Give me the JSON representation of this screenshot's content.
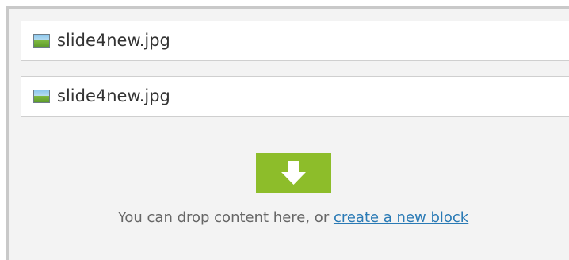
{
  "items": [
    {
      "filename": "slide4new.jpg",
      "icon": "image-file-icon"
    },
    {
      "filename": "slide4new.jpg",
      "icon": "image-file-icon"
    }
  ],
  "drop_zone": {
    "icon": "down-arrow-icon",
    "message": "You can drop content here, or ",
    "link_text": "create a new block"
  },
  "colors": {
    "accent": "#8dbd2a",
    "link": "#2a7ab5",
    "panel_background": "#f3f3f3"
  }
}
